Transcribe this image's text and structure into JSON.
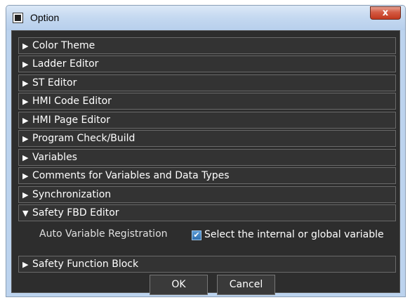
{
  "window": {
    "title": "Option",
    "close_label": "x"
  },
  "sections_top": [
    {
      "label": "Color Theme"
    },
    {
      "label": "Ladder Editor"
    },
    {
      "label": "ST Editor"
    },
    {
      "label": "HMI Code Editor"
    },
    {
      "label": "HMI Page Editor"
    },
    {
      "label": "Program Check/Build"
    },
    {
      "label": "Variables"
    },
    {
      "label": "Comments for Variables and Data Types"
    },
    {
      "label": "Synchronization"
    }
  ],
  "expanded_section": {
    "label": "Safety FBD Editor",
    "setting_label": "Auto Variable Registration",
    "checkbox_label": "Select the internal or global variable",
    "checked": true
  },
  "section_bottom": {
    "label": "Safety Function Block"
  },
  "buttons": {
    "ok": "OK",
    "cancel": "Cancel"
  },
  "icons": {
    "collapsed": "triangle-right-icon",
    "expanded": "triangle-down-icon"
  }
}
